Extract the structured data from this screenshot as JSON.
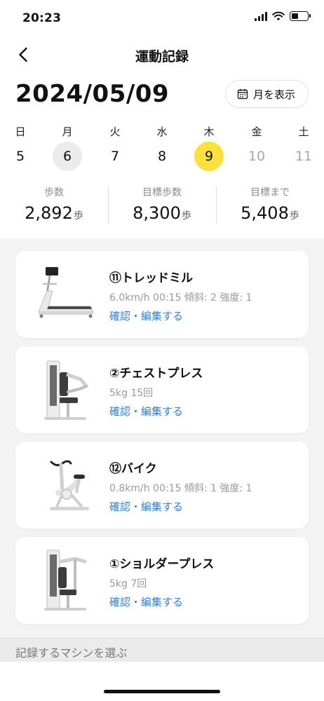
{
  "status_bar": {
    "time": "20:23"
  },
  "header": {
    "title": "運動記録",
    "back_icon": "chevron-left-icon"
  },
  "date": {
    "current": "2024/05/09",
    "month_button_label": "月を表示",
    "month_button_icon": "calendar-icon"
  },
  "week": [
    {
      "day": "日",
      "date": "5",
      "state": "normal"
    },
    {
      "day": "月",
      "date": "6",
      "state": "today"
    },
    {
      "day": "火",
      "date": "7",
      "state": "normal"
    },
    {
      "day": "水",
      "date": "8",
      "state": "normal"
    },
    {
      "day": "木",
      "date": "9",
      "state": "selected"
    },
    {
      "day": "金",
      "date": "10",
      "state": "future"
    },
    {
      "day": "土",
      "date": "11",
      "state": "future"
    }
  ],
  "stats": [
    {
      "label": "歩数",
      "value": "2,892",
      "unit": "歩"
    },
    {
      "label": "目標歩数",
      "value": "8,300",
      "unit": "歩"
    },
    {
      "label": "目標まで",
      "value": "5,408",
      "unit": "歩"
    }
  ],
  "records": [
    {
      "title": "⑪トレッドミル",
      "detail": "6.0km/h 00:15 傾斜: 2 強度: 1",
      "link": "確認・編集する",
      "icon": "treadmill-icon"
    },
    {
      "title": "②チェストプレス",
      "detail": "5kg 15回",
      "link": "確認・編集する",
      "icon": "chest-press-icon"
    },
    {
      "title": "⑫バイク",
      "detail": "0.8km/h 00:15 傾斜: 1 強度: 1",
      "link": "確認・編集する",
      "icon": "bike-icon"
    },
    {
      "title": "①ショルダープレス",
      "detail": "5kg 7回",
      "link": "確認・編集する",
      "icon": "shoulder-press-icon"
    }
  ],
  "footer": {
    "select_machine_label": "記録するマシンを選ぶ"
  },
  "colors": {
    "accent_selected": "#fce13e",
    "link": "#2f7fd6",
    "today_bg": "#ebebeb"
  }
}
